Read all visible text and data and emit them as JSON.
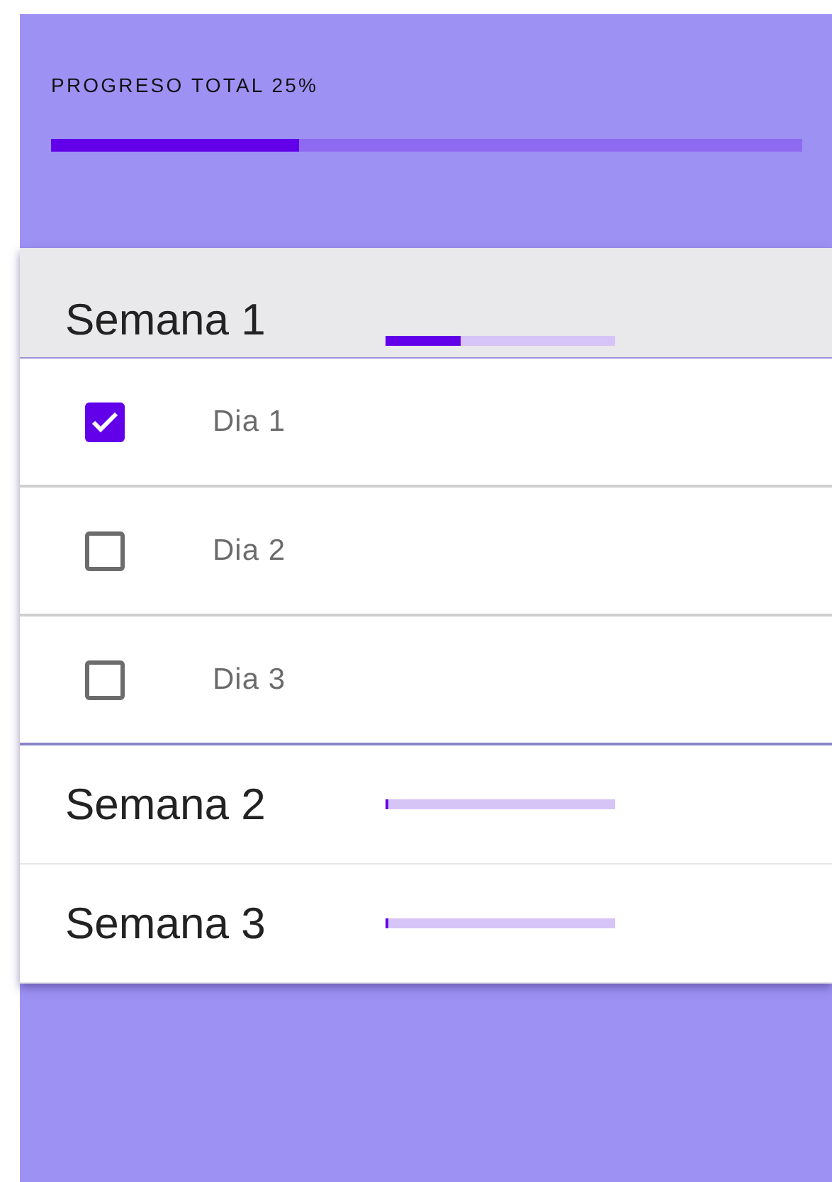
{
  "total": {
    "label": "PROGRESO TOTAL 25%",
    "level": 0.33
  },
  "weeks": [
    {
      "title": "Semana 1",
      "level": 0.33,
      "expanded": true,
      "days": [
        {
          "label": "Dia 1",
          "checked": true
        },
        {
          "label": "Dia 2",
          "checked": false
        },
        {
          "label": "Dia 3",
          "checked": false
        }
      ]
    },
    {
      "title": "Semana 2",
      "level": 0.01,
      "expanded": false
    },
    {
      "title": "Semana 3",
      "level": 0.01,
      "expanded": false
    }
  ]
}
